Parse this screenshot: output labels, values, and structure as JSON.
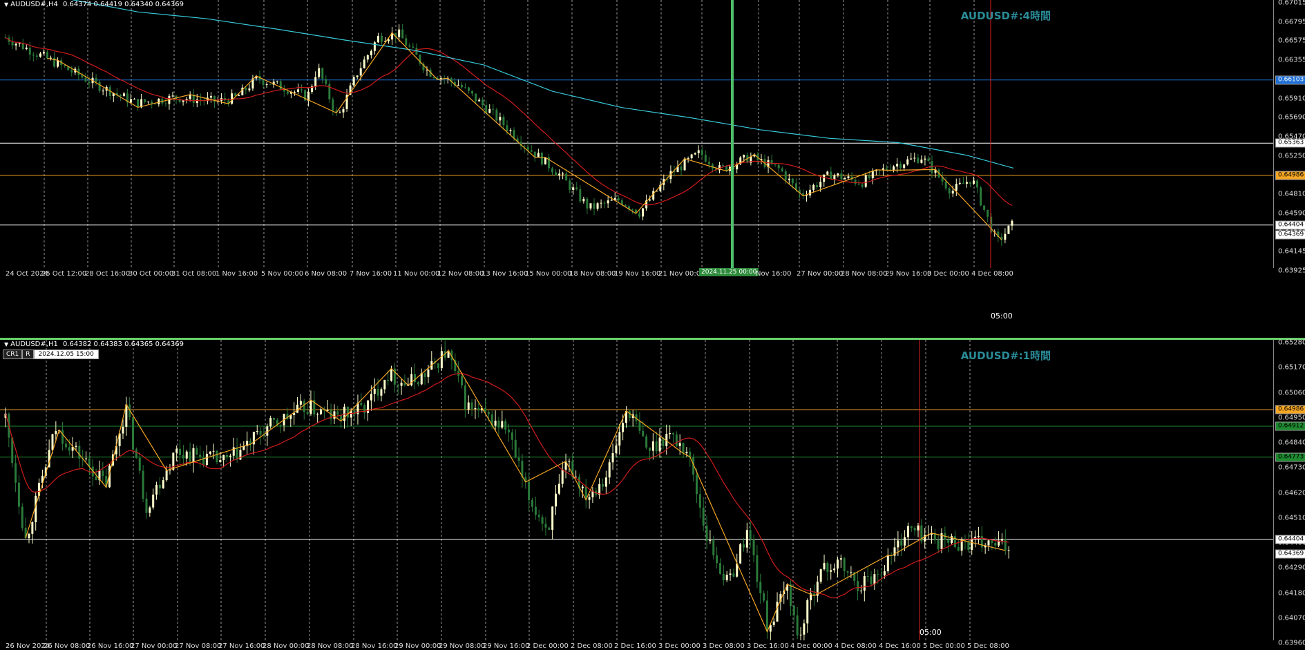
{
  "colors": {
    "up": "#ffffcc",
    "down": "#2a7a3a",
    "ma_fast": "#d21c1c",
    "ma_slow": "#39c9d9",
    "zigzag": "#f5a623",
    "level_white": "#ffffff",
    "level_orange": "#f5a623",
    "level_blue": "#1f6fd6",
    "level_green": "#1d8a2f",
    "marker_red": "#d22",
    "marker_green": "#4fc06a"
  },
  "top": {
    "title": "AUDUSD#,H4",
    "ohlc": "0.64374 0.64419 0.64340 0.64369",
    "label": "AUDUSD#:4時間",
    "y_ticks": [
      "0.67015",
      "0.66795",
      "0.66575",
      "0.66355",
      "0.66130",
      "0.65910",
      "0.65690",
      "0.65470",
      "0.65250",
      "0.65030",
      "0.64810",
      "0.64590",
      "0.64369",
      "0.64145",
      "0.63925"
    ],
    "ylim": [
      0.639,
      0.6704
    ],
    "levels": [
      {
        "price": "0.66103",
        "color": "#1f6fd6",
        "box_bg": "#1f6fd6",
        "box_fg": "#ffffff"
      },
      {
        "price": "0.65363",
        "color": "#ffffff",
        "box_bg": "#ffffff",
        "box_fg": "#000000"
      },
      {
        "price": "0.64986",
        "color": "#f5a623",
        "box_bg": "#f5a623",
        "box_fg": "#000000"
      },
      {
        "price": "0.64404",
        "color": "#ffffff",
        "box_bg": "#ffffff",
        "box_fg": "#000000"
      }
    ],
    "current_price": "0.64369",
    "x_ticks": [
      "24 Oct 2024",
      "25 Oct 12:00",
      "28 Oct 16:00",
      "30 Oct 00:00",
      "31 Oct 08:00",
      "1 Nov 16:00",
      "5 Nov 00:00",
      "6 Nov 08:00",
      "7 Nov 16:00",
      "11 Nov 00:00",
      "12 Nov 08:00",
      "13 Nov 16:00",
      "15 Nov 00:00",
      "18 Nov 08:00",
      "19 Nov 16:00",
      "21 Nov 00:00",
      "2024.11.25 00:00",
      "Nov 16:00",
      "27 Nov 00:00",
      "28 Nov 08:00",
      "29 Nov 16:00",
      "3 Dec 00:00",
      "4 Dec 08:00"
    ],
    "cursor_time": "2024.11.25 00:00",
    "time_label": "05:00"
  },
  "bottom": {
    "title": "AUDUSD#,H1",
    "ohlc": "0.64382 0.64383 0.64365 0.64369",
    "label": "AUDUSD#:1時間",
    "cr": "CR1",
    "r": "R",
    "date_box": "2024.12.05 15:00",
    "y_ticks": [
      "0.65280",
      "0.65170",
      "0.65060",
      "0.64950",
      "0.64840",
      "0.64730",
      "0.64620",
      "0.64510",
      "0.64400",
      "0.64290",
      "0.64180",
      "0.64070",
      "0.63960"
    ],
    "ylim": [
      0.6395,
      0.653
    ],
    "levels": [
      {
        "price": "0.64986",
        "color": "#f5a623",
        "box_bg": "#f5a623",
        "box_fg": "#000000"
      },
      {
        "price": "0.64912",
        "color": "#1d8a2f",
        "box_bg": "#1d8a2f",
        "box_fg": "#000000"
      },
      {
        "price": "0.64773",
        "color": "#1d8a2f",
        "box_bg": "#1d8a2f",
        "box_fg": "#000000"
      },
      {
        "price": "0.64404",
        "color": "#ffffff",
        "box_bg": "#ffffff",
        "box_fg": "#000000"
      }
    ],
    "current_price": "0.64369",
    "x_ticks": [
      "26 Nov 2024",
      "26 Nov 08:00",
      "26 Nov 16:00",
      "27 Nov 00:00",
      "27 Nov 08:00",
      "27 Nov 16:00",
      "28 Nov 00:00",
      "28 Nov 08:00",
      "28 Nov 16:00",
      "29 Nov 00:00",
      "29 Nov 08:00",
      "29 Nov 16:00",
      "2 Dec 00:00",
      "2 Dec 08:00",
      "2 Dec 16:00",
      "3 Dec 00:00",
      "3 Dec 08:00",
      "3 Dec 16:00",
      "4 Dec 00:00",
      "4 Dec 08:00",
      "4 Dec 16:00",
      "5 Dec 00:00",
      "5 Dec 08:00"
    ],
    "time_label": "05:00"
  }
}
